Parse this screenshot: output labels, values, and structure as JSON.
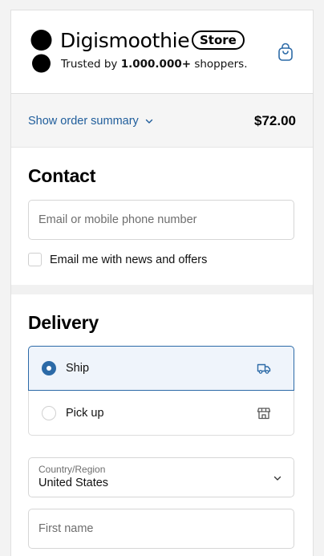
{
  "header": {
    "brand": "Digismoothie",
    "badge": "Store",
    "tagline_prefix": "Trusted by ",
    "tagline_bold": "1.000.000+",
    "tagline_suffix": " shoppers.",
    "cart_icon": "shopping-bag-icon"
  },
  "summary": {
    "toggle_label": "Show order summary",
    "total": "$72.00",
    "link_color": "#1f5d9b"
  },
  "contact": {
    "title": "Contact",
    "email_placeholder": "Email or mobile phone number",
    "newsletter_label": "Email me with news and offers",
    "newsletter_checked": false
  },
  "delivery": {
    "title": "Delivery",
    "options": [
      {
        "label": "Ship",
        "selected": true,
        "icon": "truck-icon"
      },
      {
        "label": "Pick up",
        "selected": false,
        "icon": "store-icon"
      }
    ],
    "country_label": "Country/Region",
    "country_value": "United States",
    "first_name_placeholder": "First name",
    "accent": "#2c6aa7"
  }
}
